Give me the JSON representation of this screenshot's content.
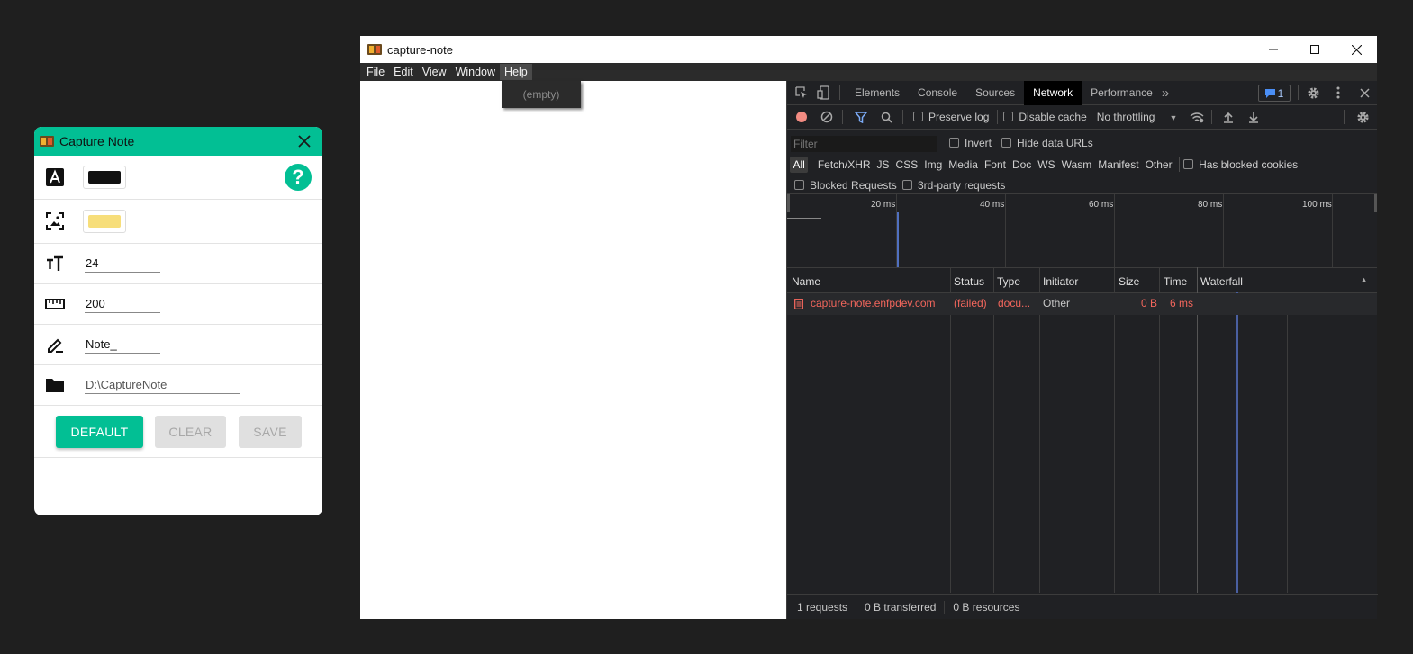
{
  "capture_note": {
    "title": "Capture Note",
    "font_color": "#111111",
    "bg_color": "#f7de7a",
    "font_size": "24",
    "width": "200",
    "prefix": "Note_",
    "folder": "D:\\CaptureNote",
    "help_label": "?",
    "buttons": {
      "default": "DEFAULT",
      "clear": "CLEAR",
      "save": "SAVE"
    }
  },
  "window": {
    "title": "capture-note",
    "menu": [
      "File",
      "Edit",
      "View",
      "Window",
      "Help"
    ],
    "help_popup": "(empty)"
  },
  "devtools": {
    "tabs": [
      "Elements",
      "Console",
      "Sources",
      "Network",
      "Performance"
    ],
    "selected_tab": "Network",
    "more": "»",
    "issues_count": "1",
    "toolbar": {
      "preserve_log": "Preserve log",
      "disable_cache": "Disable cache",
      "throttling": "No throttling"
    },
    "filter": {
      "placeholder": "Filter",
      "invert": "Invert",
      "hide_data_urls": "Hide data URLs",
      "types": [
        "All",
        "Fetch/XHR",
        "JS",
        "CSS",
        "Img",
        "Media",
        "Font",
        "Doc",
        "WS",
        "Wasm",
        "Manifest",
        "Other"
      ],
      "has_blocked_cookies": "Has blocked cookies",
      "blocked_requests": "Blocked Requests",
      "third_party": "3rd-party requests"
    },
    "timeline_labels": [
      "20 ms",
      "40 ms",
      "60 ms",
      "80 ms",
      "100 ms"
    ],
    "columns": [
      "Name",
      "Status",
      "Type",
      "Initiator",
      "Size",
      "Time",
      "Waterfall"
    ],
    "requests": [
      {
        "name": "capture-note.enfpdev.com",
        "status": "(failed)",
        "type": "docu...",
        "initiator": "Other",
        "size": "0 B",
        "time": "6 ms"
      }
    ],
    "status": {
      "requests": "1 requests",
      "transferred": "0 B transferred",
      "resources": "0 B resources"
    },
    "error_color": "#f2665c"
  }
}
